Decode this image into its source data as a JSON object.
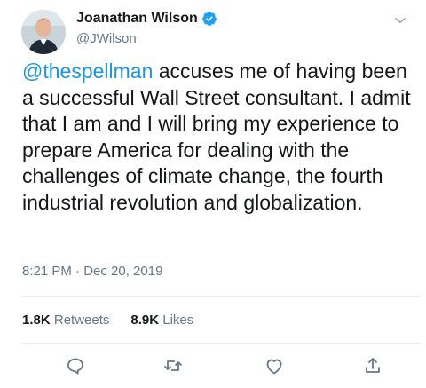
{
  "user": {
    "name": "Joanathan Wilson",
    "handle": "@JWilson"
  },
  "tweet": {
    "mention": "@thespellman",
    "text": " accuses me of having been a successful Wall Street consultant. I admit that I am and I will bring my experience to prepare America for dealing with the challenges of climate change, the fourth industrial revolution and globalization.",
    "timestamp": "8:21 PM · Dec 20, 2019"
  },
  "stats": {
    "retweets_count": "1.8K",
    "retweets_label": "Retweets",
    "likes_count": "8.9K",
    "likes_label": "Likes"
  },
  "colors": {
    "link": "#1b95e0",
    "secondary_text": "#657786",
    "divider": "#e6ecf0",
    "verified": "#1da1f2"
  },
  "icons": [
    "verified-badge-icon",
    "chevron-down-icon",
    "reply-icon",
    "retweet-icon",
    "like-icon",
    "share-icon"
  ]
}
